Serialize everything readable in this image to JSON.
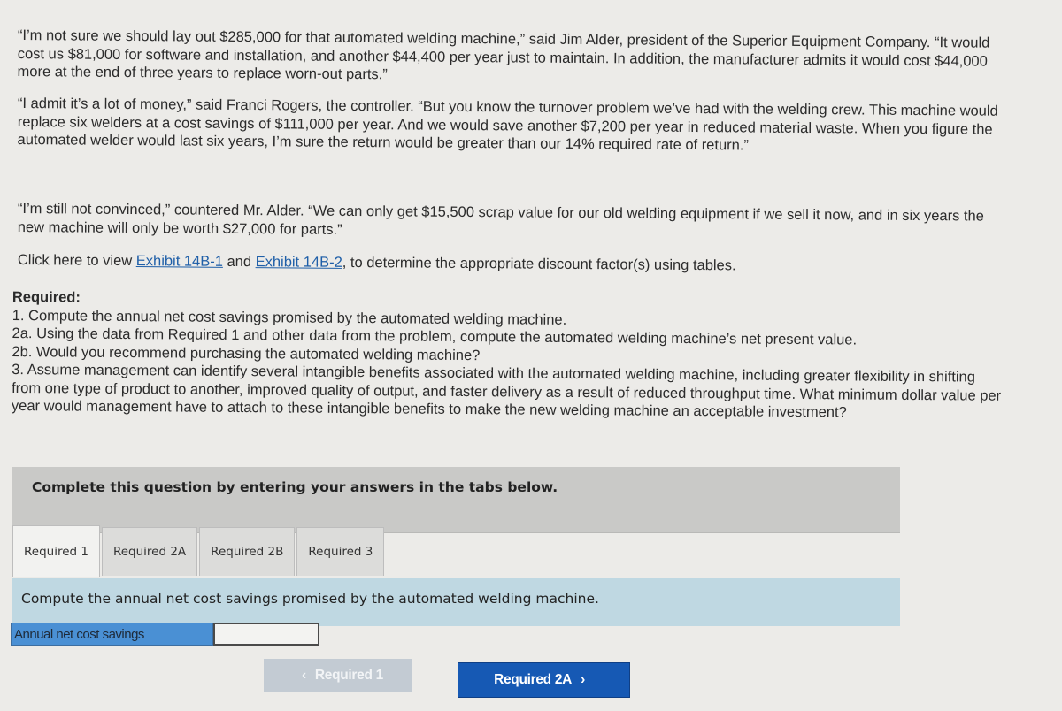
{
  "problem": {
    "paragraph_1": "“I’m not sure we should lay out $285,000 for that automated welding machine,” said Jim Alder, president of the Superior Equipment Company. “It would cost us $81,000 for software and installation, and another $44,400 per year just to maintain. In addition, the manufacturer admits it would cost $44,000 more at the end of three years to replace worn-out parts.”",
    "paragraph_2": "“I admit it’s a lot of money,” said Franci Rogers, the controller. “But you know the turnover problem we’ve had with the welding crew. This machine would replace six welders at a cost savings of $111,000 per year. And we would save another $7,200 per year in reduced material waste. When you figure the automated welder would last six years, I’m sure the return would be greater than our 14% required rate of return.”",
    "paragraph_3": "“I’m still not convinced,” countered Mr. Alder. “We can only get $15,500 scrap value for our old welding equipment if we sell it now, and in six years the new machine will only be worth $27,000 for parts.”",
    "exhibit_line": {
      "prefix": "Click here to view ",
      "link_1": "Exhibit 14B-1",
      "middle": " and ",
      "link_2": "Exhibit 14B-2",
      "suffix": ", to determine the appropriate discount factor(s) using tables."
    }
  },
  "required": {
    "title": "Required:",
    "items": [
      "1. Compute the annual net cost savings promised by the automated welding machine.",
      "2a. Using the data from Required 1 and other data from the problem, compute the automated welding machine’s net present value.",
      "2b. Would you recommend purchasing the automated welding machine?",
      "3. Assume management can identify several intangible benefits associated with the automated welding machine, including greater flexibility in shifting from one type of product to another, improved quality of output, and faster delivery as a result of reduced throughput time. What minimum dollar value per year would management have to attach to these intangible benefits to make the new welding machine an acceptable investment?"
    ]
  },
  "instructions": "Complete this question by entering your answers in the tabs below.",
  "tabs": [
    {
      "label": "Required 1",
      "active": true
    },
    {
      "label": "Required 2A",
      "active": false
    },
    {
      "label": "Required 2B",
      "active": false
    },
    {
      "label": "Required 3",
      "active": false
    }
  ],
  "active_panel": {
    "question": "Compute the annual net cost savings promised by the automated welding machine.",
    "field_label": "Annual net cost savings",
    "field_value": ""
  },
  "navigation": {
    "prev_label": "Required 1",
    "next_label": "Required 2A",
    "prev_icon": "chevron-left-icon",
    "next_icon": "chevron-right-icon"
  }
}
